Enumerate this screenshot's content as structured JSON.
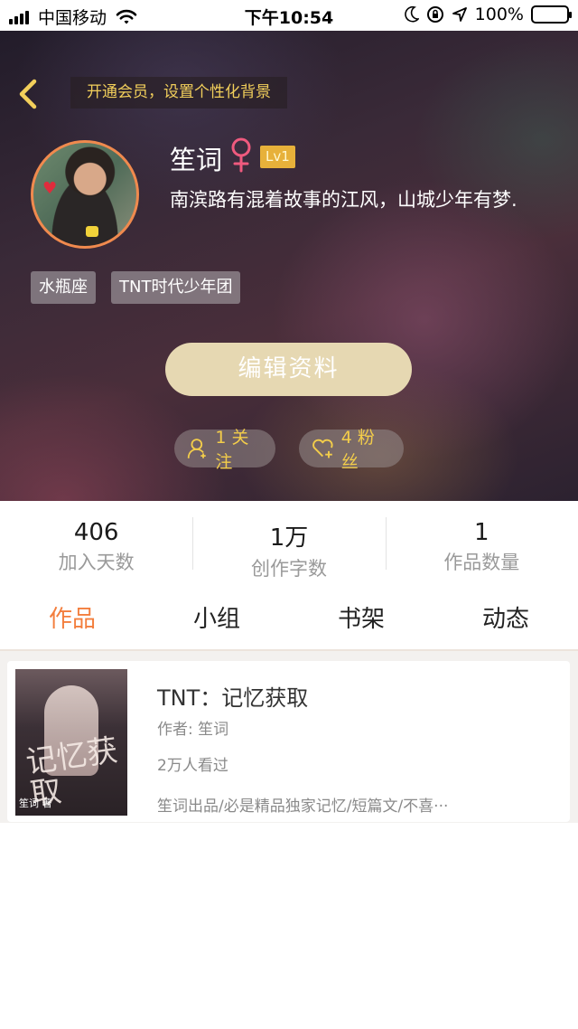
{
  "status_bar": {
    "carrier": "中国移动",
    "time": "下午10:54",
    "battery": "100%",
    "battery_level": 1.0
  },
  "header": {
    "vip_banner": "开通会员，设置个性化背景",
    "username": "笙词",
    "gender": "female-symbol",
    "level": "Lv1",
    "bio": "南滨路有混着故事的江风，山城少年有梦.",
    "tags": [
      "水瓶座",
      "TNT时代少年团"
    ],
    "edit_button": "编辑资料",
    "following": "1 关注",
    "fans": "4 粉丝"
  },
  "stats": [
    {
      "value": "406",
      "label": "加入天数"
    },
    {
      "value": "1万",
      "label": "创作字数"
    },
    {
      "value": "1",
      "label": "作品数量"
    }
  ],
  "tabs": [
    {
      "label": "作品",
      "active": true
    },
    {
      "label": "小组",
      "active": false
    },
    {
      "label": "书架",
      "active": false
    },
    {
      "label": "动态",
      "active": false
    }
  ],
  "works": [
    {
      "title": "TNT：记忆获取",
      "author": "作者: 笙词",
      "views": "2万人看过",
      "description": "笙词出品/必是精品独家记忆/短篇文/不喜···",
      "cover_text": "记忆获取",
      "cover_author": "笙词 著"
    }
  ],
  "colors": {
    "accent": "#f37e3d",
    "gold": "#f2cf5b",
    "level_badge": "#e7b13a",
    "edit_button": "#e6d8b2",
    "avatar_border": "#f08a4e"
  }
}
